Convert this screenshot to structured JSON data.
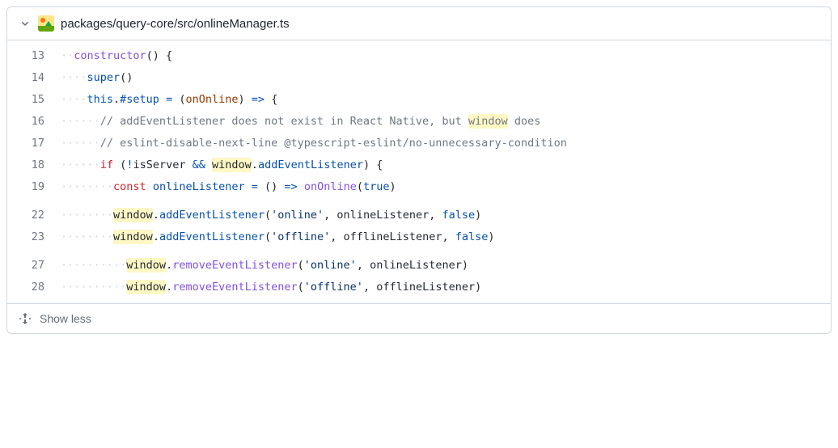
{
  "file": {
    "path": "packages/query-core/src/onlineManager.ts"
  },
  "footer": {
    "show_less": "Show less"
  },
  "highlight_word": "window",
  "whitespace_glyph": "·",
  "lines": [
    {
      "num": 13,
      "indent": 2,
      "tokens": [
        {
          "t": "constructor",
          "c": "tok-fn"
        },
        {
          "t": "() {",
          "c": "tok-pl"
        }
      ]
    },
    {
      "num": 14,
      "indent": 4,
      "tokens": [
        {
          "t": "super",
          "c": "tok-prop"
        },
        {
          "t": "()",
          "c": "tok-pl"
        }
      ]
    },
    {
      "num": 15,
      "indent": 4,
      "tokens": [
        {
          "t": "this",
          "c": "tok-prop"
        },
        {
          "t": ".",
          "c": "tok-pl"
        },
        {
          "t": "#setup",
          "c": "tok-prop"
        },
        {
          "t": " ",
          "c": "tok-pl"
        },
        {
          "t": "=",
          "c": "tok-op"
        },
        {
          "t": " (",
          "c": "tok-pl"
        },
        {
          "t": "onOnline",
          "c": "tok-var2"
        },
        {
          "t": ") ",
          "c": "tok-pl"
        },
        {
          "t": "=>",
          "c": "tok-op"
        },
        {
          "t": " {",
          "c": "tok-pl"
        }
      ]
    },
    {
      "num": 16,
      "indent": 6,
      "tokens": [
        {
          "t": "// addEventListener does not exist in React Native, but ",
          "c": "tok-cm"
        },
        {
          "t": "window",
          "c": "tok-cm",
          "hl": true
        },
        {
          "t": " does",
          "c": "tok-cm"
        }
      ]
    },
    {
      "num": 17,
      "indent": 6,
      "tokens": [
        {
          "t": "// eslint-disable-next-line @typescript-eslint/no-unnecessary-condition",
          "c": "tok-cm"
        }
      ]
    },
    {
      "num": 18,
      "indent": 6,
      "tokens": [
        {
          "t": "if",
          "c": "tok-kw"
        },
        {
          "t": " (",
          "c": "tok-pl"
        },
        {
          "t": "!",
          "c": "tok-op"
        },
        {
          "t": "isServer ",
          "c": "tok-pl"
        },
        {
          "t": "&&",
          "c": "tok-op"
        },
        {
          "t": " ",
          "c": "tok-pl"
        },
        {
          "t": "window",
          "c": "tok-pl",
          "hl": true
        },
        {
          "t": ".",
          "c": "tok-pl"
        },
        {
          "t": "addEventListener",
          "c": "tok-prop"
        },
        {
          "t": ") {",
          "c": "tok-pl"
        }
      ]
    },
    {
      "num": 19,
      "indent": 8,
      "tokens": [
        {
          "t": "const",
          "c": "tok-kw"
        },
        {
          "t": " ",
          "c": "tok-pl"
        },
        {
          "t": "onlineListener",
          "c": "tok-prop"
        },
        {
          "t": " ",
          "c": "tok-pl"
        },
        {
          "t": "=",
          "c": "tok-op"
        },
        {
          "t": " () ",
          "c": "tok-pl"
        },
        {
          "t": "=>",
          "c": "tok-op"
        },
        {
          "t": " ",
          "c": "tok-pl"
        },
        {
          "t": "onOnline",
          "c": "tok-fn"
        },
        {
          "t": "(",
          "c": "tok-pl"
        },
        {
          "t": "true",
          "c": "tok-bool"
        },
        {
          "t": ")",
          "c": "tok-pl"
        }
      ]
    },
    {
      "gap": true
    },
    {
      "num": 22,
      "indent": 8,
      "tokens": [
        {
          "t": "window",
          "c": "tok-pl",
          "hl": true
        },
        {
          "t": ".",
          "c": "tok-pl"
        },
        {
          "t": "addEventListener",
          "c": "tok-prop"
        },
        {
          "t": "(",
          "c": "tok-pl"
        },
        {
          "t": "'online'",
          "c": "tok-str"
        },
        {
          "t": ", onlineListener, ",
          "c": "tok-pl"
        },
        {
          "t": "false",
          "c": "tok-bool"
        },
        {
          "t": ")",
          "c": "tok-pl"
        }
      ]
    },
    {
      "num": 23,
      "indent": 8,
      "tokens": [
        {
          "t": "window",
          "c": "tok-pl",
          "hl": true
        },
        {
          "t": ".",
          "c": "tok-pl"
        },
        {
          "t": "addEventListener",
          "c": "tok-prop"
        },
        {
          "t": "(",
          "c": "tok-pl"
        },
        {
          "t": "'offline'",
          "c": "tok-str"
        },
        {
          "t": ", offlineListener, ",
          "c": "tok-pl"
        },
        {
          "t": "false",
          "c": "tok-bool"
        },
        {
          "t": ")",
          "c": "tok-pl"
        }
      ]
    },
    {
      "gap": true
    },
    {
      "num": 27,
      "indent": 10,
      "tokens": [
        {
          "t": "window",
          "c": "tok-pl",
          "hl": true
        },
        {
          "t": ".",
          "c": "tok-pl"
        },
        {
          "t": "removeEventListener",
          "c": "tok-fn"
        },
        {
          "t": "(",
          "c": "tok-pl"
        },
        {
          "t": "'online'",
          "c": "tok-str"
        },
        {
          "t": ", onlineListener)",
          "c": "tok-pl"
        }
      ]
    },
    {
      "num": 28,
      "indent": 10,
      "tokens": [
        {
          "t": "window",
          "c": "tok-pl",
          "hl": true
        },
        {
          "t": ".",
          "c": "tok-pl"
        },
        {
          "t": "removeEventListener",
          "c": "tok-fn"
        },
        {
          "t": "(",
          "c": "tok-pl"
        },
        {
          "t": "'offline'",
          "c": "tok-str"
        },
        {
          "t": ", offlineListener)",
          "c": "tok-pl"
        }
      ]
    }
  ]
}
